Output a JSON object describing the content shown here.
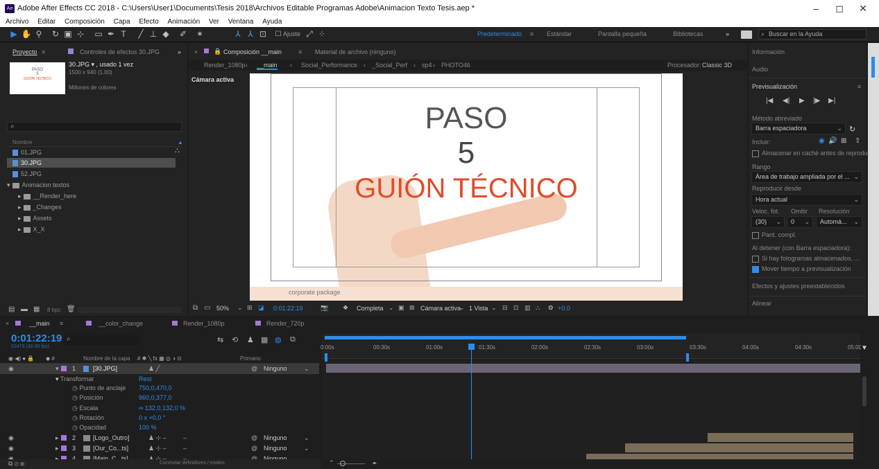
{
  "app": {
    "logo": "Ae",
    "title": "Adobe After Effects CC 2018 - C:\\Users\\User1\\Documents\\Tesis 2018\\Archivos Editable Programas Adobe\\Animacion Texto Tesis.aep *",
    "minimize": "–",
    "maximize": "◻",
    "close": "✕"
  },
  "menu": [
    "Archivo",
    "Editar",
    "Composición",
    "Capa",
    "Efecto",
    "Animación",
    "Ver",
    "Ventana",
    "Ayuda"
  ],
  "toolbar": {
    "ajuste": "Ajuste",
    "workspaces": [
      "Predeterminado",
      "≡",
      "Estándar",
      "Pantalla pequeña",
      "Bibliotecas",
      "»"
    ],
    "search_placeholder": "Buscar en la Ayuda"
  },
  "project": {
    "tab": "Proyecto",
    "tab_menu": "≡",
    "effects_tab": "Controles de efectos 30.JPG",
    "more": "»",
    "file_name": "30.JPG ▾ , usado 1 vez",
    "file_dims": "1500 x 940 (1.00)",
    "file_color": "Millones de colores",
    "thumb_text": [
      "PASO",
      "5",
      "GUIÓN TÉCNICO"
    ],
    "search_icon": "⌕",
    "column": "Nombre",
    "items": [
      "01.JPG",
      "30.JPG",
      "52.JPG",
      "Animacion textos",
      "__Render_here",
      "_Changes",
      "Assets",
      "X_X"
    ],
    "bpc": "8 bpc"
  },
  "comp": {
    "close": "×",
    "tab": "Composición __main",
    "tab_menu": "≡",
    "footage_tab": "Material de archivo (ninguno)",
    "breadcrumbs": [
      "Render_1080p",
      "__main",
      "Social_Performance",
      "_Social_Perf",
      "sp4",
      "PHOTO46"
    ],
    "renderer_label": "Procesador:",
    "renderer": "Classic 3D",
    "camera_label": "Cámara activa",
    "viewer_text": [
      "PASO",
      "5",
      "GUIÓN TÉCNICO"
    ],
    "bottom_text": "corporate package",
    "zoom": "50%",
    "timecode": "0:01:22:19",
    "quality": "Completa",
    "camera": "Cámara activa",
    "views": "1 Vista",
    "exposure": "+0.0"
  },
  "right": {
    "info": "Información",
    "audio": "Audio",
    "preview": "Previsualización",
    "preview_menu": "≡",
    "transport": [
      "|◀",
      "◀|",
      "▶",
      "|▶",
      "▶|"
    ],
    "shortcut_label": "Método abreviado",
    "shortcut": "Barra espaciadora",
    "include_label": "Incluir:",
    "cache_label": "Almacenar en caché antes de reprodu",
    "range_label": "Rango",
    "range": "Área de trabajo ampliada por el ...",
    "playfrom_label": "Reproducir desde",
    "playfrom": "Hora actual",
    "cols": [
      "Veloc. fot.",
      "Omitir",
      "Resolución"
    ],
    "fps": "(30)",
    "skip": "0",
    "res": "Automá...",
    "full_label": "Pant. compl.",
    "stop_label": "Al detener (con Barra espaciadora):",
    "stop_opt1": "Si hay fotogramas almacenados, ...",
    "stop_opt2": "Mover tiempo a previsualización",
    "effects": "Efectos y ajustes preestablecidos",
    "align": "Alinear"
  },
  "timeline": {
    "tabs": [
      "__main",
      "__color_change",
      "Render_1080p",
      "Render_720p"
    ],
    "tab_menu": "≡",
    "close": "×",
    "timecode": "0:01:22:19",
    "frames": "02479 (30.00 fps)",
    "search_icon": "⌕",
    "col_name": "Nombre de la capa",
    "col_parent": "Primario",
    "col_switches": "# ✱ ╲ fx ▦ ◎ ◑ ⊙",
    "layer1": {
      "num": "1",
      "name": "[30.JPG]",
      "parent": "Ninguno"
    },
    "transform": "Transformar",
    "reset": "Rest",
    "props": [
      {
        "name": "Punto de anclaje",
        "value": "750,0,470,0"
      },
      {
        "name": "Posición",
        "value": "960,0,377,0"
      },
      {
        "name": "Escala",
        "value": "∞ 132,0,132,0 %"
      },
      {
        "name": "Rotación",
        "value": "0 x +0,0 °"
      },
      {
        "name": "Opacidad",
        "value": "100 %"
      }
    ],
    "layers": [
      {
        "num": "2",
        "name": "[Logo_Outro]",
        "parent": "Ninguno"
      },
      {
        "num": "3",
        "name": "[Our_Co...ts]",
        "parent": "Ninguno"
      },
      {
        "num": "4",
        "name": "[Main_C...ts]",
        "parent": "Ninguno"
      }
    ],
    "ruler": [
      "0:00s",
      "00:30s",
      "01:00s",
      "01:30s",
      "02:00s",
      "02:30s",
      "03:00s",
      "03:30s",
      "04:00s",
      "04:30s",
      "05:00s"
    ],
    "footer": "Conmutar definidores / modos",
    "playhead_sec": 82.6,
    "duration_sec": 300,
    "workarea_end_sec": 205,
    "layer_spans": [
      [
        217,
        300
      ],
      [
        170,
        300
      ],
      [
        148,
        300
      ]
    ]
  },
  "colors": {
    "accent": "#2d8ceb",
    "title_red": "#e14b2a",
    "layer_bar": "#6b6474",
    "tan_bar": "#7a6c58",
    "viewer_bg": "#ffffff"
  }
}
